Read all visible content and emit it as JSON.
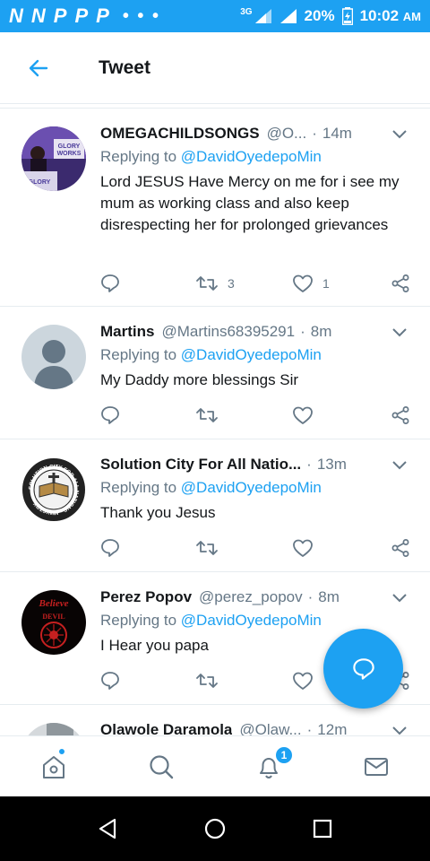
{
  "status_bar": {
    "left_icons": [
      "N",
      "N",
      "P",
      "P",
      "P"
    ],
    "overflow_dots": "• • •",
    "network": "3G",
    "battery": "20%",
    "time": "10:02",
    "ampm": "AM"
  },
  "header": {
    "title": "Tweet"
  },
  "tweets": [
    {
      "name": "OMEGACHILDSONGS",
      "handle": "@O...",
      "time": "14m",
      "replying_prefix": "Replying to ",
      "replying_to": "@DavidOyedepoMin",
      "text": "Lord JESUS Have Mercy on me for i see my mum as working class and also keep disrespecting her for prolonged grievances",
      "retweets": "3",
      "likes": "1",
      "avatar_text": [
        "GLORY",
        "WORKS",
        "GLORY"
      ]
    },
    {
      "name": "Martins",
      "handle": "@Martins68395291",
      "time": "8m",
      "replying_prefix": "Replying to ",
      "replying_to": "@DavidOyedepoMin",
      "text": "My Daddy more blessings Sir",
      "retweets": "",
      "likes": ""
    },
    {
      "name": "Solution City For All Natio...",
      "handle": "",
      "time": "13m",
      "replying_prefix": "Replying to ",
      "replying_to": "@DavidOyedepoMin",
      "text": "Thank you Jesus",
      "retweets": "",
      "likes": "",
      "avatar_text": "SOLUTION CITY FOR ALL NATIONS · MINISTRY ·"
    },
    {
      "name": "Perez Popov",
      "handle": "@perez_popov",
      "time": "8m",
      "replying_prefix": "Replying to ",
      "replying_to": "@DavidOyedepoMin",
      "text": "I Hear you papa",
      "retweets": "",
      "likes": "",
      "avatar_text": [
        "Believe",
        "DEVIL"
      ]
    },
    {
      "name": "Olawole Daramola",
      "handle": "@Olaw...",
      "time": "12m"
    }
  ],
  "separator": "·",
  "bottom_nav": {
    "items": [
      "home-icon",
      "search-icon",
      "notifications-icon",
      "messages-icon"
    ],
    "notification_count": "1"
  },
  "colors": {
    "accent": "#1da1f2",
    "text": "#14171a",
    "muted": "#657786"
  }
}
